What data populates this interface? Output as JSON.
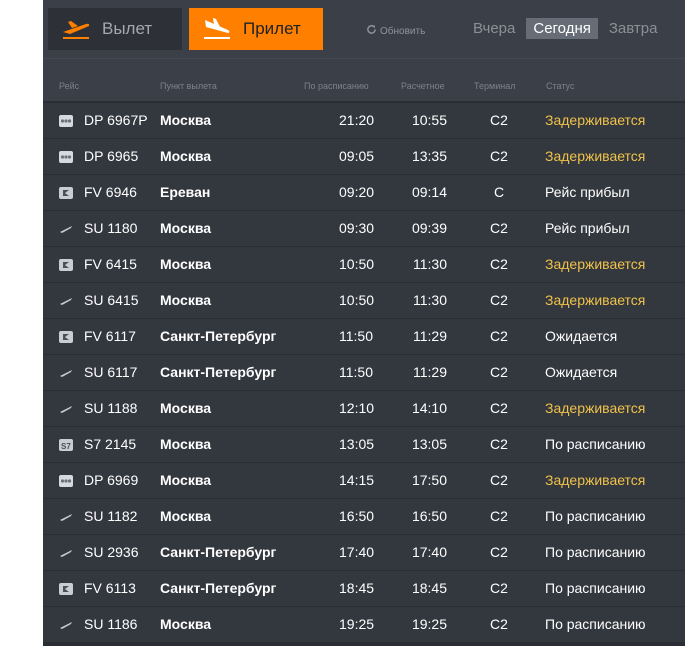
{
  "tabs": {
    "departure": {
      "label": "Вылет",
      "icon": "plane-departure-icon"
    },
    "arrival": {
      "label": "Прилет",
      "icon": "plane-arrival-icon"
    }
  },
  "refresh": {
    "label": "Обновить",
    "icon": "refresh-icon"
  },
  "days": [
    {
      "label": "Вчера",
      "active": false
    },
    {
      "label": "Сегодня",
      "active": true
    },
    {
      "label": "Завтра",
      "active": false
    }
  ],
  "columns": {
    "flight": "Рейс",
    "origin": "Пункт вылета",
    "scheduled": "По расписанию",
    "estimated": "Расчетное",
    "terminal": "Терминал",
    "status": "Статус"
  },
  "colors": {
    "accent": "#ff7f00",
    "delayed": "#f0c24a",
    "row_bg": "#33373e"
  },
  "flights": [
    {
      "airline_icon": "dp-logo-icon",
      "flight": "DP 6967P",
      "city": "Москва",
      "scheduled": "21:20",
      "estimated": "10:55",
      "terminal": "C2",
      "status": "Задерживается",
      "delayed": true
    },
    {
      "airline_icon": "dp-logo-icon",
      "flight": "DP 6965",
      "city": "Москва",
      "scheduled": "09:05",
      "estimated": "13:35",
      "terminal": "C2",
      "status": "Задерживается",
      "delayed": true
    },
    {
      "airline_icon": "fv-logo-icon",
      "flight": "FV 6946",
      "city": "Ереван",
      "scheduled": "09:20",
      "estimated": "09:14",
      "terminal": "C",
      "status": "Рейс прибыл",
      "delayed": false
    },
    {
      "airline_icon": "su-logo-icon",
      "flight": "SU 1180",
      "city": "Москва",
      "scheduled": "09:30",
      "estimated": "09:39",
      "terminal": "C2",
      "status": "Рейс прибыл",
      "delayed": false
    },
    {
      "airline_icon": "fv-logo-icon",
      "flight": "FV 6415",
      "city": "Москва",
      "scheduled": "10:50",
      "estimated": "11:30",
      "terminal": "C2",
      "status": "Задерживается",
      "delayed": true
    },
    {
      "airline_icon": "su-logo-icon",
      "flight": "SU 6415",
      "city": "Москва",
      "scheduled": "10:50",
      "estimated": "11:30",
      "terminal": "C2",
      "status": "Задерживается",
      "delayed": true
    },
    {
      "airline_icon": "fv-logo-icon",
      "flight": "FV 6117",
      "city": "Санкт-Петербург",
      "scheduled": "11:50",
      "estimated": "11:29",
      "terminal": "C2",
      "status": "Ожидается",
      "delayed": false
    },
    {
      "airline_icon": "su-logo-icon",
      "flight": "SU 6117",
      "city": "Санкт-Петербург",
      "scheduled": "11:50",
      "estimated": "11:29",
      "terminal": "C2",
      "status": "Ожидается",
      "delayed": false
    },
    {
      "airline_icon": "su-logo-icon",
      "flight": "SU 1188",
      "city": "Москва",
      "scheduled": "12:10",
      "estimated": "14:10",
      "terminal": "C2",
      "status": "Задерживается",
      "delayed": true
    },
    {
      "airline_icon": "s7-logo-icon",
      "flight": "S7 2145",
      "city": "Москва",
      "scheduled": "13:05",
      "estimated": "13:05",
      "terminal": "C2",
      "status": "По расписанию",
      "delayed": false
    },
    {
      "airline_icon": "dp-logo-icon",
      "flight": "DP 6969",
      "city": "Москва",
      "scheduled": "14:15",
      "estimated": "17:50",
      "terminal": "C2",
      "status": "Задерживается",
      "delayed": true
    },
    {
      "airline_icon": "su-logo-icon",
      "flight": "SU 1182",
      "city": "Москва",
      "scheduled": "16:50",
      "estimated": "16:50",
      "terminal": "C2",
      "status": "По расписанию",
      "delayed": false
    },
    {
      "airline_icon": "su-logo-icon",
      "flight": "SU 2936",
      "city": "Санкт-Петербург",
      "scheduled": "17:40",
      "estimated": "17:40",
      "terminal": "C2",
      "status": "По расписанию",
      "delayed": false
    },
    {
      "airline_icon": "fv-logo-icon",
      "flight": "FV 6113",
      "city": "Санкт-Петербург",
      "scheduled": "18:45",
      "estimated": "18:45",
      "terminal": "C2",
      "status": "По расписанию",
      "delayed": false
    },
    {
      "airline_icon": "su-logo-icon",
      "flight": "SU 1186",
      "city": "Москва",
      "scheduled": "19:25",
      "estimated": "19:25",
      "terminal": "C2",
      "status": "По расписанию",
      "delayed": false
    }
  ]
}
